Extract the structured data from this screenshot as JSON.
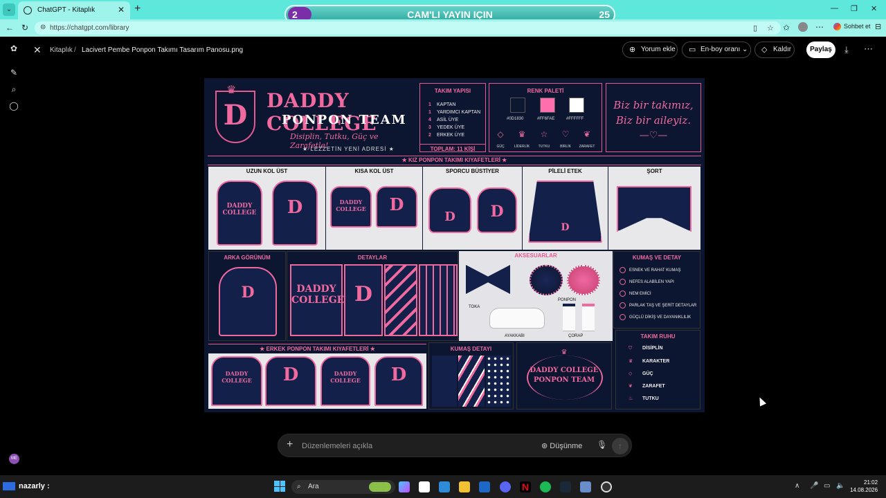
{
  "browser": {
    "tab_title": "ChatGPT - Kitaplık",
    "url": "https://chatgpt.com/library",
    "chat_button": "Sohbet et",
    "banner": {
      "left": "2",
      "title": "CAM'LI YAYIN IÇIN",
      "right": "25"
    }
  },
  "topbar": {
    "breadcrumb_root": "Kitaplık",
    "breadcrumb_sep": "/",
    "filename": "Lacivert Pembe Ponpon Takımı Tasarım Panosu.png",
    "comment": "Yorum ekle",
    "aspect": "En-boy oranı",
    "remove": "Kaldır",
    "share": "Paylaş"
  },
  "board": {
    "brand": "DADDY COLLEGE",
    "brand_sub": "PONPON TEAM",
    "motto": "Disiplin, Tutku, Güç ve Zarafetle!",
    "tagline": "★ LEZZETİN YENİ ADRESİ ★",
    "roster_title": "TAKIM YAPISI",
    "roster": [
      {
        "n": "1",
        "role": "KAPTAN"
      },
      {
        "n": "1",
        "role": "YARDIMCI KAPTAN"
      },
      {
        "n": "4",
        "role": "ASİL ÜYE"
      },
      {
        "n": "3",
        "role": "YEDEK ÜYE"
      },
      {
        "n": "2",
        "role": "ERKEK ÜYE"
      }
    ],
    "roster_total": "TOPLAM: 11 KİŞİ",
    "palette_title": "RENK PALETİ",
    "colors": [
      {
        "hex": "#0D1830",
        "label": "#0D1830"
      },
      {
        "hex": "#FF6FAE",
        "label": "#FF6FAE"
      },
      {
        "hex": "#FFFFFF",
        "label": "#FFFFFF"
      }
    ],
    "values": [
      {
        "icon": "gem-icon",
        "label": "GÜÇ"
      },
      {
        "icon": "crown-icon",
        "label": "LİDERLİK"
      },
      {
        "icon": "star-icon",
        "label": "TUTKU"
      },
      {
        "icon": "heart-icon",
        "label": "BİRLİK"
      },
      {
        "icon": "laurel-icon",
        "label": "ZARAFET"
      }
    ],
    "slogan1": "Biz bir takımız,",
    "slogan2": "Biz bir aileyiz.",
    "girls_title": "★ KIZ PONPON TAKIMI KIYAFETLERİ ★",
    "girls_items": [
      "UZUN KOL ÜST",
      "KISA KOL ÜST",
      "SPORCU BÜSTİYER",
      "PİLELİ ETEK",
      "ŞORT"
    ],
    "back_title": "ARKA GÖRÜNÜM",
    "details_title": "DETAYLAR",
    "acc_title": "AKSESUARLAR",
    "acc_labels": [
      "TOKA",
      "PONPON",
      "AYAKKABI",
      "ÇORAP"
    ],
    "fabric_title": "KUMAŞ VE DETAY",
    "fabric": [
      "ESNEK VE RAHAT KUMAŞ",
      "NEFES ALABİLEN YAPI",
      "NEM EMİCİ",
      "PARLAK TAŞ VE ŞERİT DETAYLAR",
      "GÜÇLÜ DİKİŞ VE DAYANIKLILIK"
    ],
    "boys_title": "★ ERKEK PONPON TAKIMI KIYAFETLERİ ★",
    "fabric_detail_title": "KUMAŞ DETAYI",
    "logo_line1": "DADDY COLLEGE",
    "logo_line2": "PONPON TEAM",
    "spirit_title": "TAKIM RUHU",
    "spirit": [
      "DİSİPLİN",
      "KARAKTER",
      "GÜÇ",
      "ZARAFET",
      "TUTKU"
    ],
    "garment_text": "DADDY COLLEGE",
    "letter": "D"
  },
  "composer": {
    "placeholder": "Düzenlemeleri açıkla",
    "think": "Düşünme"
  },
  "taskbar": {
    "user": "nazarly :",
    "search": "Ara",
    "time": "21:02",
    "date": "14.08.2026"
  }
}
